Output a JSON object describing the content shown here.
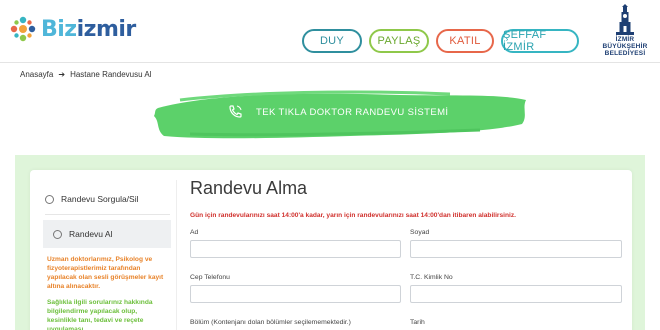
{
  "header": {
    "logo": {
      "part1": "Biz",
      "part2": "izmir"
    },
    "nav": [
      {
        "label": "DUY",
        "color": "#2f8f9e"
      },
      {
        "label": "PAYLAŞ",
        "color": "#6aa82f"
      },
      {
        "label": "KATIL",
        "color": "#e05a3c"
      },
      {
        "label": "ŞEFFAF İZMİR",
        "color": "#2ba3b0"
      }
    ],
    "city_logo": {
      "line1": "İZMİR",
      "line2": "BÜYÜKŞEHİR",
      "line3": "BELEDİYESİ"
    }
  },
  "breadcrumb": {
    "home": "Anasayfa",
    "current": "Hastane Randevusu Al"
  },
  "banner": {
    "text": "TEK TIKLA DOKTOR RANDEVU SİSTEMİ",
    "icon": "phone-icon",
    "color": "#5cd16a"
  },
  "sidebar": {
    "items": [
      {
        "label": "Randevu Sorgula/Sil",
        "icon": "clock-icon"
      },
      {
        "label": "Randevu Al",
        "icon": "target-icon"
      }
    ],
    "note_orange": "Uzman doktorlarımız, Psikolog ve fizyoterapistlerimiz tarafından yapılacak olan sesli görüşmeler kayıt altına alınacaktır.",
    "note_green": "Sağlıkla ilgili sorularınız hakkında bilgilendirme yapılacak olup, kesinlikle tanı, tedavi ve reçete uygulaması"
  },
  "form": {
    "title": "Randevu Alma",
    "warning": "Gün için randevularınızı saat 14:00'a kadar, yarın için randevularınızı saat 14:00'dan itibaren alabilirsiniz.",
    "fields": {
      "ad": {
        "label": "Ad",
        "value": ""
      },
      "soyad": {
        "label": "Soyad",
        "value": ""
      },
      "tel": {
        "label": "Cep Telefonu",
        "value": ""
      },
      "tc": {
        "label": "T.C. Kimlik No",
        "value": ""
      },
      "bolum": {
        "label": "Bölüm (Kontenjanı dolan bölümler seçilememektedir.)"
      },
      "tarih": {
        "label": "Tarih"
      }
    }
  }
}
